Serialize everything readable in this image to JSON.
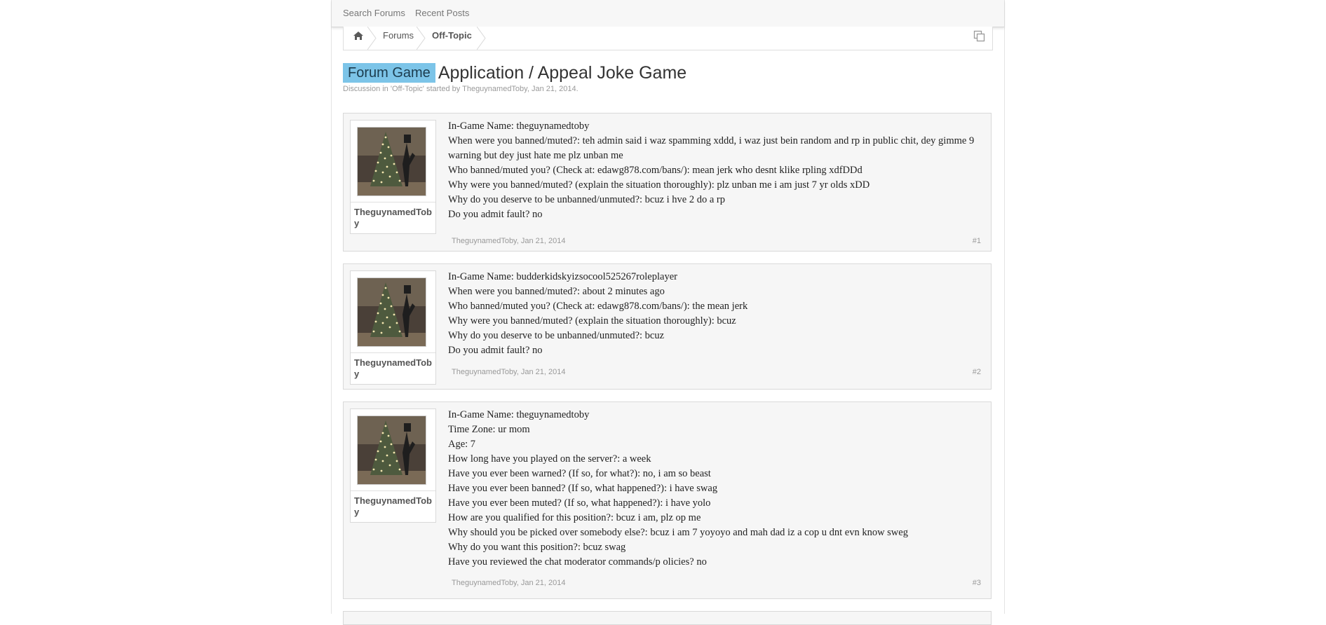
{
  "topbar": {
    "search_forums": "Search Forums",
    "recent_posts": "Recent Posts"
  },
  "breadcrumb": {
    "home_icon": "home-icon",
    "forums": "Forums",
    "current": "Off-Topic",
    "copy_icon": "copy-icon"
  },
  "thread": {
    "prefix": "Forum Game",
    "title": "Application / Appeal Joke Game",
    "meta_prefix": "Discussion in '",
    "meta_forum": "Off-Topic",
    "meta_mid": "' started by ",
    "meta_author": "TheguynamedToby",
    "meta_sep": ", ",
    "meta_date": "Jan 21, 2014",
    "meta_end": "."
  },
  "posts": [
    {
      "username": "TheguynamedToby",
      "lines": [
        "In-Game Name: theguynamedtoby",
        "When were you banned/muted?: teh admin said i waz spamming xddd, i waz just bein random and rp in public chit, dey gimme 9 warning but dey just hate me plz unban me",
        "Who banned/muted you? (Check at: edawg878.com/bans/): mean jerk who desnt klike rpling xdfDDd",
        "Why were you banned/muted? (explain the situation thoroughly): plz unban me i am just 7 yr olds xDD",
        "Why do you deserve to be unbanned/unmuted?: bcuz i hve 2 do a rp",
        "Do you admit fault? no"
      ],
      "footer_author": "TheguynamedToby",
      "footer_date": "Jan 21, 2014",
      "number": "#1"
    },
    {
      "username": "TheguynamedToby",
      "lines": [
        "In-Game Name: budderkidskyizsocool525267roleplayer",
        "When were you banned/muted?: about 2 minutes ago",
        "Who banned/muted you? (Check at: edawg878.com/bans/): the mean jerk",
        "Why were you banned/muted? (explain the situation thoroughly): bcuz",
        "Why do you deserve to be unbanned/unmuted?: bcuz",
        "Do you admit fault? no"
      ],
      "footer_author": "TheguynamedToby",
      "footer_date": "Jan 21, 2014",
      "number": "#2"
    },
    {
      "username": "TheguynamedToby",
      "lines": [
        "In-Game Name: theguynamedtoby",
        "Time Zone: ur mom",
        "Age: 7",
        "How long have you played on the server?: a week",
        "Have you ever been warned? (If so, for what?): no, i am so beast",
        "Have you ever been banned? (If so, what happened?): i have swag",
        "Have you ever been muted? (If so, what happened?): i have yolo",
        "How are you qualified for this position?: bcuz i am, plz op me",
        "Why should you be picked over somebody else?: bcuz i am 7 yoyoyo and mah dad iz a cop u dnt evn know sweg",
        "Why do you want this position?: bcuz swag",
        "Have you reviewed the chat moderator commands/p olicies? no"
      ],
      "footer_author": "TheguynamedToby",
      "footer_date": "Jan 21, 2014",
      "number": "#3"
    }
  ]
}
